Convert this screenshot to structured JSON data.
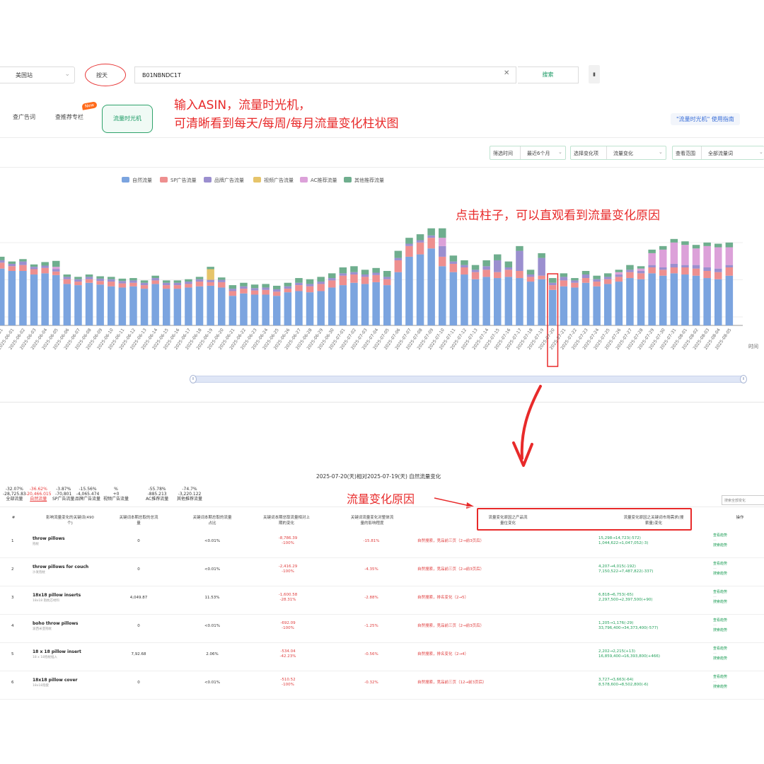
{
  "search": {
    "site": "美国站",
    "mode": "按天",
    "asin": "B01NBNDC1T",
    "button": "搜索"
  },
  "tabs": {
    "ad_words": "查广告词",
    "recommend": "查推荐专栏",
    "new_badge": "New",
    "time_machine": "流量时光机"
  },
  "annotations": {
    "top_line1": "输入ASIN，流量时光机，",
    "top_line2": "可清晰看到每天/每周/每月流量变化柱状图",
    "middle": "点击柱子，可以直观看到流量变化原因",
    "bottom": "流量变化原因"
  },
  "guide_link": "\"流量时光机\" 使用指南",
  "filters": {
    "time_label": "筛选时间",
    "time_value": "最近6个月",
    "dim_label": "选择变化项",
    "dim_value": "流量变化",
    "scope_label": "查看范围",
    "scope_value": "全部流量词"
  },
  "legend": [
    {
      "name": "自然流量",
      "color": "#7ba4df"
    },
    {
      "name": "SP广告流量",
      "color": "#ee8f8f"
    },
    {
      "name": "品牌广告流量",
      "color": "#9b8fcf"
    },
    {
      "name": "视频广告流量",
      "color": "#e6c46a"
    },
    {
      "name": "AC推荐流量",
      "color": "#dca1d9"
    },
    {
      "name": "其他推荐流量",
      "color": "#6fae8e"
    }
  ],
  "chart_data": {
    "type": "bar",
    "stacked": true,
    "x_axis_label": "时间",
    "categories": [
      "2025-05-31",
      "2025-06-01",
      "2025-06-02",
      "2025-06-03",
      "2025-06-04",
      "2025-06-05",
      "2025-06-06",
      "2025-06-07",
      "2025-06-08",
      "2025-06-09",
      "2025-06-10",
      "2025-06-11",
      "2025-06-12",
      "2025-06-13",
      "2025-06-14",
      "2025-06-15",
      "2025-06-16",
      "2025-06-17",
      "2025-06-18",
      "2025-06-19",
      "2025-06-20",
      "2025-06-21",
      "2025-06-22",
      "2025-06-23",
      "2025-06-24",
      "2025-06-25",
      "2025-06-26",
      "2025-06-27",
      "2025-06-28",
      "2025-06-29",
      "2025-06-30",
      "2025-07-01",
      "2025-07-02",
      "2025-07-03",
      "2025-07-04",
      "2025-07-05",
      "2025-07-06",
      "2025-07-07",
      "2025-07-08",
      "2025-07-09",
      "2025-07-10",
      "2025-07-11",
      "2025-07-12",
      "2025-07-13",
      "2025-07-14",
      "2025-07-15",
      "2025-07-16",
      "2025-07-17",
      "2025-07-18",
      "2025-07-19",
      "2025-07-20",
      "2025-07-21",
      "2025-07-22",
      "2025-07-23",
      "2025-07-24",
      "2025-07-25",
      "2025-07-26",
      "2025-07-27",
      "2025-07-28",
      "2025-07-29",
      "2025-07-30",
      "2025-07-31",
      "2025-08-01",
      "2025-08-02",
      "2025-08-03",
      "2025-08-04",
      "2025-08-05"
    ],
    "visible_tick_labels": [
      "2025-06-01",
      "2025-06-02",
      "2025-06-03",
      "2025-06-04",
      "2025-06-05",
      "2025-06-06",
      "2025-06-07",
      "2025-06-08",
      "2025-06-09",
      "2025-06-10",
      "2025-06-11",
      "2025-06-12",
      "2025-06-13",
      "2025-06-14",
      "2025-06-15",
      "2025-06-16",
      "2025-06-17",
      "2025-06-18",
      "2025-06-19",
      "2025-06-20",
      "2025-06-21",
      "2025-06-22",
      "2025-06-23",
      "2025-06-24",
      "2025-06-25",
      "2025-06-26",
      "2025-06-27",
      "2025-06-28",
      "2025-06-29",
      "2025-06-30",
      "2025-07-01",
      "2025-07-02",
      "2025-07-03",
      "2025-07-04",
      "2025-07-05",
      "2025-07-06",
      "2025-07-07",
      "2025-07-08",
      "2025-07-09",
      "2025-07-10",
      "2025-07-11",
      "2025-07-12",
      "2025-07-13",
      "2025-07-14",
      "2025-07-15",
      "2025-07-16",
      "2025-07-17",
      "2025-07-18",
      "2025-07-19",
      "2025-07-20",
      "2025-07-21",
      "2025-07-22",
      "2025-07-23",
      "2025-07-24",
      "2025-07-25",
      "2025-07-26",
      "2025-07-27",
      "2025-07-28",
      "2025-07-29",
      "2025-07-30",
      "2025-07-31",
      "2025-08-01",
      "2025-08-02",
      "2025-08-03",
      "2025-08-04",
      "2025-08-05"
    ],
    "series": [
      {
        "name": "自然流量",
        "values": [
          96,
          92,
          92,
          86,
          88,
          85,
          70,
          68,
          72,
          69,
          66,
          64,
          66,
          62,
          70,
          62,
          62,
          64,
          66,
          67,
          64,
          50,
          54,
          52,
          52,
          50,
          56,
          58,
          56,
          58,
          64,
          68,
          72,
          70,
          73,
          68,
          90,
          116,
          120,
          130,
          100,
          90,
          86,
          78,
          82,
          80,
          82,
          80,
          74,
          78,
          60,
          66,
          64,
          72,
          66,
          70,
          74,
          80,
          78,
          88,
          84,
          88,
          86,
          84,
          80,
          78,
          84
        ]
      },
      {
        "name": "SP广告流量",
        "values": [
          10,
          8,
          10,
          9,
          9,
          6,
          8,
          6,
          6,
          6,
          8,
          7,
          6,
          6,
          6,
          6,
          6,
          6,
          8,
          6,
          9,
          8,
          8,
          7,
          8,
          7,
          6,
          10,
          10,
          12,
          12,
          16,
          14,
          12,
          12,
          10,
          20,
          18,
          20,
          18,
          16,
          14,
          12,
          12,
          12,
          10,
          12,
          12,
          8,
          6,
          8,
          10,
          8,
          8,
          8,
          8,
          8,
          10,
          10,
          10,
          10,
          10,
          12,
          12,
          12,
          12,
          14
        ]
      },
      {
        "name": "品牌广告流量",
        "values": [
          4,
          4,
          6,
          4,
          4,
          4,
          4,
          4,
          4,
          4,
          4,
          4,
          4,
          4,
          4,
          4,
          4,
          4,
          4,
          4,
          4,
          4,
          4,
          4,
          4,
          4,
          4,
          4,
          4,
          4,
          4,
          4,
          4,
          4,
          4,
          4,
          4,
          4,
          4,
          4,
          18,
          4,
          4,
          4,
          6,
          20,
          4,
          34,
          4,
          30,
          4,
          6,
          4,
          6,
          4,
          4,
          4,
          4,
          4,
          4,
          4,
          6,
          4,
          6,
          6,
          6,
          4
        ]
      },
      {
        "name": "视频广告流量",
        "values": [
          0,
          0,
          0,
          0,
          0,
          0,
          0,
          0,
          0,
          0,
          0,
          0,
          0,
          0,
          0,
          0,
          0,
          0,
          0,
          18,
          0,
          0,
          0,
          0,
          0,
          0,
          0,
          0,
          0,
          0,
          0,
          0,
          0,
          0,
          0,
          0,
          0,
          0,
          0,
          0,
          0,
          0,
          0,
          0,
          0,
          0,
          0,
          0,
          0,
          0,
          0,
          0,
          0,
          0,
          0,
          0,
          0,
          0,
          0,
          0,
          0,
          0,
          0,
          0,
          0,
          0,
          0
        ]
      },
      {
        "name": "AC推荐流量",
        "values": [
          0,
          0,
          0,
          0,
          0,
          4,
          0,
          0,
          0,
          0,
          0,
          0,
          0,
          0,
          0,
          0,
          0,
          0,
          0,
          0,
          0,
          0,
          0,
          0,
          0,
          0,
          0,
          0,
          0,
          0,
          0,
          0,
          0,
          0,
          0,
          0,
          0,
          0,
          0,
          0,
          14,
          0,
          0,
          0,
          0,
          0,
          0,
          0,
          0,
          0,
          0,
          0,
          0,
          0,
          0,
          0,
          4,
          0,
          4,
          20,
          30,
          36,
          34,
          28,
          36,
          36,
          30
        ]
      },
      {
        "name": "其他推荐流量",
        "values": [
          6,
          4,
          4,
          4,
          6,
          10,
          4,
          4,
          4,
          4,
          4,
          4,
          4,
          4,
          4,
          4,
          4,
          4,
          4,
          4,
          4,
          6,
          6,
          6,
          6,
          6,
          6,
          8,
          8,
          8,
          8,
          10,
          10,
          8,
          8,
          10,
          12,
          10,
          10,
          12,
          16,
          10,
          8,
          8,
          10,
          10,
          10,
          8,
          8,
          8,
          8,
          6,
          4,
          6,
          6,
          6,
          4,
          8,
          4,
          6,
          6,
          6,
          6,
          6,
          6,
          6,
          8
        ]
      }
    ],
    "highlighted_category": "2025-07-20",
    "ylim": [
      0,
      190
    ],
    "legend_position": "top-center"
  },
  "compare": {
    "title": "2025-07-20(天)相对2025-07-19(天) 自然流量变化",
    "summary": [
      {
        "pct": "-32.07%",
        "value": "-28,725.83",
        "label": "全部流量"
      },
      {
        "pct": "-36.62%",
        "value": "-20,466.015",
        "label": "自然流量",
        "active": true
      },
      {
        "pct": "-3.87%",
        "value": "-70,801",
        "label": "SP广告流量"
      },
      {
        "pct": "-15.56%",
        "value": "-4,065.474",
        "label": "品牌广告流量"
      },
      {
        "pct": "%",
        "value": "+0",
        "label": "视频广告流量"
      },
      {
        "pct": "-55.78%",
        "value": "-885.213",
        "label": "AC推荐流量"
      },
      {
        "pct": "-74.7%",
        "value": "-3,220.122",
        "label": "其他推荐流量"
      }
    ],
    "search_placeholder": "搜索全部变化",
    "headers": {
      "idx": "#",
      "keyword": "影响流量变化的关键词(490个)",
      "total": "关键词本期总取的总流量",
      "share": "关键词本期总取的流量占比",
      "change": "关键词本期总取流量相对上期的变化",
      "impact": "关键词流量变化对整体流量的影响程度",
      "reason_product": "流量变化原因之产品流量位变化",
      "reason_keyword": "流量变化原因之关键词市场需求(搜索量)变化",
      "ops": "操作"
    },
    "rows": [
      {
        "idx": "1",
        "kw": "throw pillows",
        "kw_cn": "抱枕",
        "total": "0",
        "share": "<0.01%",
        "chg1": "-8,786.39",
        "chg2": "-100%",
        "impact": "-15.81%",
        "reason": "自然搜索，竞品前三页（2→前3页后）",
        "mk1": "15,298→14,723(-572)",
        "mk2": "1,044,622→1,047,052(-3)"
      },
      {
        "idx": "2",
        "kw": "throw pillows for couch",
        "kw_cn": "沙发抱枕",
        "total": "0",
        "share": "<0.01%",
        "chg1": "-2,416.29",
        "chg2": "-100%",
        "impact": "-4.35%",
        "reason": "自然搜索，竞品前三页（2→前3页后）",
        "mk1": "4,207→4,015(-192)",
        "mk2": "7,150,522→7,487,822(-337)"
      },
      {
        "idx": "3",
        "kw": "18x18 pillow inserts",
        "kw_cn": "18x18 抱枕芯材料",
        "total": "4,049.87",
        "share": "11.53%",
        "chg1": "-1,600.58",
        "chg2": "-28.31%",
        "impact": "-2.88%",
        "reason": "自然搜索，排名变化（2→5）",
        "mk1": "6,818→6,753(-65)",
        "mk2": "2,297,500→2,397,500(+90)"
      },
      {
        "idx": "4",
        "kw": "boho throw pillows",
        "kw_cn": "波西米亚抱枕",
        "total": "0",
        "share": "<0.01%",
        "chg1": "-692.09",
        "chg2": "-100%",
        "impact": "-1.25%",
        "reason": "自然搜索，竞品前三页（2→前3页后）",
        "mk1": "1,205→1,176(-29)",
        "mk2": "33,796,400→34,373,400(-577)"
      },
      {
        "idx": "5",
        "kw": "18 x 18 pillow insert",
        "kw_cn": "18 x 18抱枕插入",
        "total": "7,92.68",
        "share": "2.06%",
        "chg1": "-534.04",
        "chg2": "-42.23%",
        "impact": "-0.56%",
        "reason": "自然搜索，排名变化（2→4）",
        "mk1": "2,202→2,215(+13)",
        "mk2": "16,859,400→16,393,800(+466)"
      },
      {
        "idx": "6",
        "kw": "18x18 pillow cover",
        "kw_cn": "18x18抱套",
        "total": "0",
        "share": "<0.01%",
        "chg1": "-510.52",
        "chg2": "-100%",
        "impact": "-0.32%",
        "reason": "自然搜索，竞品前三页（12→前3页后）",
        "mk1": "3,727→3,663(-64)",
        "mk2": "8,578,600→8,502,800(-6)"
      }
    ],
    "ops": [
      "查看趋势",
      "搜索趋势"
    ]
  }
}
